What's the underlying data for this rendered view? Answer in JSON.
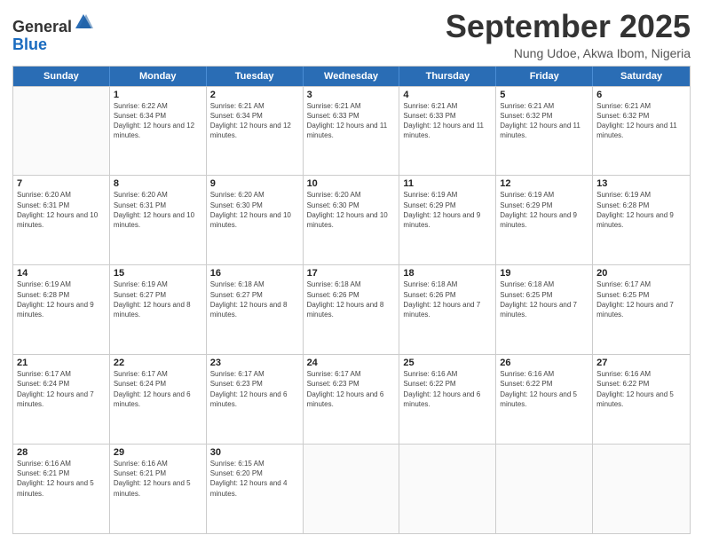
{
  "header": {
    "logo": {
      "general": "General",
      "blue": "Blue"
    },
    "title": "September 2025",
    "subtitle": "Nung Udoe, Akwa Ibom, Nigeria"
  },
  "days_of_week": [
    "Sunday",
    "Monday",
    "Tuesday",
    "Wednesday",
    "Thursday",
    "Friday",
    "Saturday"
  ],
  "weeks": [
    [
      {
        "day": "",
        "info": ""
      },
      {
        "day": "1",
        "info": "Sunrise: 6:22 AM\nSunset: 6:34 PM\nDaylight: 12 hours and 12 minutes."
      },
      {
        "day": "2",
        "info": "Sunrise: 6:21 AM\nSunset: 6:34 PM\nDaylight: 12 hours and 12 minutes."
      },
      {
        "day": "3",
        "info": "Sunrise: 6:21 AM\nSunset: 6:33 PM\nDaylight: 12 hours and 11 minutes."
      },
      {
        "day": "4",
        "info": "Sunrise: 6:21 AM\nSunset: 6:33 PM\nDaylight: 12 hours and 11 minutes."
      },
      {
        "day": "5",
        "info": "Sunrise: 6:21 AM\nSunset: 6:32 PM\nDaylight: 12 hours and 11 minutes."
      },
      {
        "day": "6",
        "info": "Sunrise: 6:21 AM\nSunset: 6:32 PM\nDaylight: 12 hours and 11 minutes."
      }
    ],
    [
      {
        "day": "7",
        "info": "Sunrise: 6:20 AM\nSunset: 6:31 PM\nDaylight: 12 hours and 10 minutes."
      },
      {
        "day": "8",
        "info": "Sunrise: 6:20 AM\nSunset: 6:31 PM\nDaylight: 12 hours and 10 minutes."
      },
      {
        "day": "9",
        "info": "Sunrise: 6:20 AM\nSunset: 6:30 PM\nDaylight: 12 hours and 10 minutes."
      },
      {
        "day": "10",
        "info": "Sunrise: 6:20 AM\nSunset: 6:30 PM\nDaylight: 12 hours and 10 minutes."
      },
      {
        "day": "11",
        "info": "Sunrise: 6:19 AM\nSunset: 6:29 PM\nDaylight: 12 hours and 9 minutes."
      },
      {
        "day": "12",
        "info": "Sunrise: 6:19 AM\nSunset: 6:29 PM\nDaylight: 12 hours and 9 minutes."
      },
      {
        "day": "13",
        "info": "Sunrise: 6:19 AM\nSunset: 6:28 PM\nDaylight: 12 hours and 9 minutes."
      }
    ],
    [
      {
        "day": "14",
        "info": "Sunrise: 6:19 AM\nSunset: 6:28 PM\nDaylight: 12 hours and 9 minutes."
      },
      {
        "day": "15",
        "info": "Sunrise: 6:19 AM\nSunset: 6:27 PM\nDaylight: 12 hours and 8 minutes."
      },
      {
        "day": "16",
        "info": "Sunrise: 6:18 AM\nSunset: 6:27 PM\nDaylight: 12 hours and 8 minutes."
      },
      {
        "day": "17",
        "info": "Sunrise: 6:18 AM\nSunset: 6:26 PM\nDaylight: 12 hours and 8 minutes."
      },
      {
        "day": "18",
        "info": "Sunrise: 6:18 AM\nSunset: 6:26 PM\nDaylight: 12 hours and 7 minutes."
      },
      {
        "day": "19",
        "info": "Sunrise: 6:18 AM\nSunset: 6:25 PM\nDaylight: 12 hours and 7 minutes."
      },
      {
        "day": "20",
        "info": "Sunrise: 6:17 AM\nSunset: 6:25 PM\nDaylight: 12 hours and 7 minutes."
      }
    ],
    [
      {
        "day": "21",
        "info": "Sunrise: 6:17 AM\nSunset: 6:24 PM\nDaylight: 12 hours and 7 minutes."
      },
      {
        "day": "22",
        "info": "Sunrise: 6:17 AM\nSunset: 6:24 PM\nDaylight: 12 hours and 6 minutes."
      },
      {
        "day": "23",
        "info": "Sunrise: 6:17 AM\nSunset: 6:23 PM\nDaylight: 12 hours and 6 minutes."
      },
      {
        "day": "24",
        "info": "Sunrise: 6:17 AM\nSunset: 6:23 PM\nDaylight: 12 hours and 6 minutes."
      },
      {
        "day": "25",
        "info": "Sunrise: 6:16 AM\nSunset: 6:22 PM\nDaylight: 12 hours and 6 minutes."
      },
      {
        "day": "26",
        "info": "Sunrise: 6:16 AM\nSunset: 6:22 PM\nDaylight: 12 hours and 5 minutes."
      },
      {
        "day": "27",
        "info": "Sunrise: 6:16 AM\nSunset: 6:22 PM\nDaylight: 12 hours and 5 minutes."
      }
    ],
    [
      {
        "day": "28",
        "info": "Sunrise: 6:16 AM\nSunset: 6:21 PM\nDaylight: 12 hours and 5 minutes."
      },
      {
        "day": "29",
        "info": "Sunrise: 6:16 AM\nSunset: 6:21 PM\nDaylight: 12 hours and 5 minutes."
      },
      {
        "day": "30",
        "info": "Sunrise: 6:15 AM\nSunset: 6:20 PM\nDaylight: 12 hours and 4 minutes."
      },
      {
        "day": "",
        "info": ""
      },
      {
        "day": "",
        "info": ""
      },
      {
        "day": "",
        "info": ""
      },
      {
        "day": "",
        "info": ""
      }
    ]
  ]
}
